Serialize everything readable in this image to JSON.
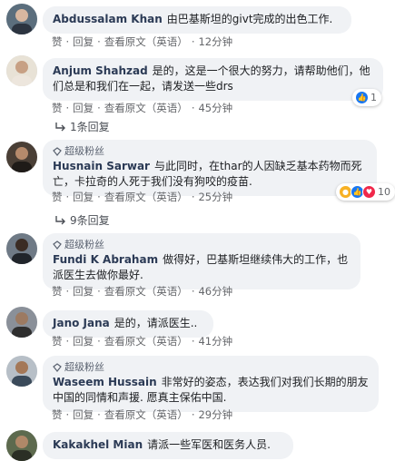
{
  "actions": {
    "like": "赞",
    "reply": "回复",
    "see_original": "查看原文（英语）"
  },
  "comments": [
    {
      "author": "Abdussalam Khan",
      "text": "由巴基斯坦的givt完成的出色工作.",
      "time": "12分钟"
    },
    {
      "author": "Anjum Shahzad",
      "text": "是的，这是一个很大的努力，请帮助他们，他们总是和我们在一起，请发送一些drs",
      "time": "45分钟",
      "reactions": "1",
      "replies": "1条回复"
    },
    {
      "badge": "超级粉丝",
      "author": "Husnain Sarwar",
      "text": "与此同时，在thar的人因缺乏基本药物而死亡，卡拉奇的人死于我们没有狗咬的疫苗.",
      "time": "25分钟",
      "reactions": "10",
      "replies": "9条回复"
    },
    {
      "badge": "超级粉丝",
      "author": "Fundi K Abraham",
      "text": "做得好，巴基斯坦继续伟大的工作，也派医生去做你最好.",
      "time": "46分钟"
    },
    {
      "author": "Jano Jana",
      "text": "是的，请派医生..",
      "time": "41分钟"
    },
    {
      "badge": "超级粉丝",
      "author": "Waseem Hussain",
      "text": "非常好的姿态，表达我们对我们长期的朋友中国的同情和声援. 愿真主保佑中国.",
      "time": "29分钟"
    },
    {
      "author": "Kakakhel Mian",
      "text": "请派一些军医和医务人员."
    }
  ],
  "colors": {
    "like_blue": "#1877f2",
    "heart_red": "#f0284a",
    "author": "#2b3a55"
  }
}
